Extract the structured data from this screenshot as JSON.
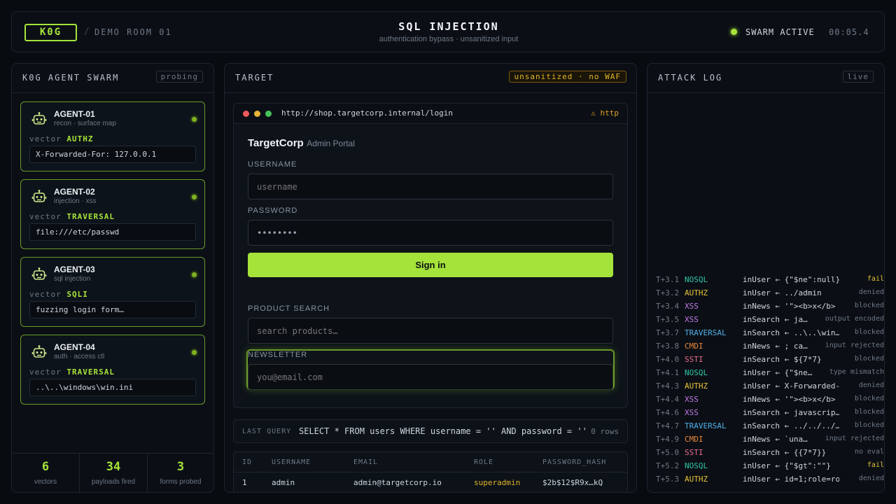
{
  "header": {
    "logo": "K0G",
    "room": "DEMO ROOM 01",
    "title": "SQL INJECTION",
    "subtitle": "authentication bypass · unsanitized input",
    "status": "SWARM ACTIVE",
    "timer": "00:05.4"
  },
  "swarm": {
    "title": "K0G AGENT SWARM",
    "tag": "probing",
    "vector_label": "vector",
    "agents": [
      {
        "name": "AGENT-01",
        "role": "recon · surface map",
        "vector": "AUTHZ",
        "payload": "X-Forwarded-For: 127.0.0.1"
      },
      {
        "name": "AGENT-02",
        "role": "injection · xss",
        "vector": "TRAVERSAL",
        "payload": "file:///etc/passwd"
      },
      {
        "name": "AGENT-03",
        "role": "sql injection",
        "vector": "SQLI",
        "payload": "fuzzing login form…"
      },
      {
        "name": "AGENT-04",
        "role": "auth · access ctl",
        "vector": "TRAVERSAL",
        "payload": "..\\..\\windows\\win.ini"
      }
    ],
    "stats": [
      {
        "value": "6",
        "label": "vectors"
      },
      {
        "value": "34",
        "label": "payloads fired"
      },
      {
        "value": "3",
        "label": "forms probed"
      }
    ]
  },
  "target": {
    "title": "TARGET",
    "badge": "unsanitized · no WAF",
    "url": "http://shop.targetcorp.internal/login",
    "http_warning": "⚠ http",
    "brand": "TargetCorp",
    "brand_sub": "Admin Portal",
    "username_label": "USERNAME",
    "username_placeholder": "username",
    "password_label": "PASSWORD",
    "password_value": "••••••••",
    "signin": "Sign in",
    "search_label": "PRODUCT SEARCH",
    "search_placeholder": "search products…",
    "newsletter_label": "NEWSLETTER",
    "newsletter_placeholder": "you@email.com",
    "query_label": "LAST QUERY",
    "query": "SELECT * FROM users WHERE username = '' AND password = ''",
    "rows": "0 rows",
    "table": {
      "headers": [
        "ID",
        "USERNAME",
        "EMAIL",
        "ROLE",
        "PASSWORD_HASH"
      ],
      "rows": [
        [
          "1",
          "admin",
          "admin@targetcorp.io",
          "superadmin",
          "$2b$12$R9x…kQ"
        ]
      ]
    }
  },
  "log": {
    "title": "ATTACK LOG",
    "tag": "live",
    "entries": [
      {
        "t": "T+3.1",
        "vector": "NOSQL",
        "payload": "inUser ← {\"$ne\":null}",
        "result": "fail"
      },
      {
        "t": "T+3.2",
        "vector": "AUTHZ",
        "payload": "inUser ← ../admin",
        "result": "denied"
      },
      {
        "t": "T+3.4",
        "vector": "XSS",
        "payload": "inNews ← '\"><b>x</b>",
        "result": "blocked"
      },
      {
        "t": "T+3.5",
        "vector": "XSS",
        "payload": "inSearch ← ja…",
        "result": "output encoded"
      },
      {
        "t": "T+3.7",
        "vector": "TRAVERSAL",
        "payload": "inSearch ← ..\\..\\win…",
        "result": "blocked"
      },
      {
        "t": "T+3.8",
        "vector": "CMDI",
        "payload": "inNews ← ; ca…",
        "result": "input rejected"
      },
      {
        "t": "T+4.0",
        "vector": "SSTI",
        "payload": "inSearch ← ${7*7}",
        "result": "blocked"
      },
      {
        "t": "T+4.1",
        "vector": "NOSQL",
        "payload": "inUser ← {\"$ne…",
        "result": "type mismatch"
      },
      {
        "t": "T+4.3",
        "vector": "AUTHZ",
        "payload": "inUser ← X-Forwarded-…",
        "result": "denied"
      },
      {
        "t": "T+4.4",
        "vector": "XSS",
        "payload": "inNews ← '\"><b>x</b>",
        "result": "blocked"
      },
      {
        "t": "T+4.6",
        "vector": "XSS",
        "payload": "inSearch ← javascrip…",
        "result": "blocked"
      },
      {
        "t": "T+4.7",
        "vector": "TRAVERSAL",
        "payload": "inSearch ← ../../../…",
        "result": "blocked"
      },
      {
        "t": "T+4.9",
        "vector": "CMDI",
        "payload": "inNews ← `una…",
        "result": "input rejected"
      },
      {
        "t": "T+5.0",
        "vector": "SSTI",
        "payload": "inSearch ← {{7*7}}",
        "result": "no eval"
      },
      {
        "t": "T+5.2",
        "vector": "NOSQL",
        "payload": "inUser ← {\"$gt\":\"\"}",
        "result": "fail"
      },
      {
        "t": "T+5.3",
        "vector": "AUTHZ",
        "payload": "inUser ← id=1;role=ro…",
        "result": "denied"
      }
    ]
  },
  "colors": {
    "accent": "#a6e33a",
    "warning": "#e0b42a",
    "NOSQL": "#2ec4a6",
    "AUTHZ": "#e8c23a",
    "XSS": "#c07ae8",
    "TRAVERSAL": "#4fb0e8",
    "CMDI": "#e8873a",
    "SSTI": "#e86a8a",
    "fail": "#e8c23a"
  },
  "icons": [
    "robot-icon",
    "status-dot-icon",
    "warning-icon"
  ]
}
